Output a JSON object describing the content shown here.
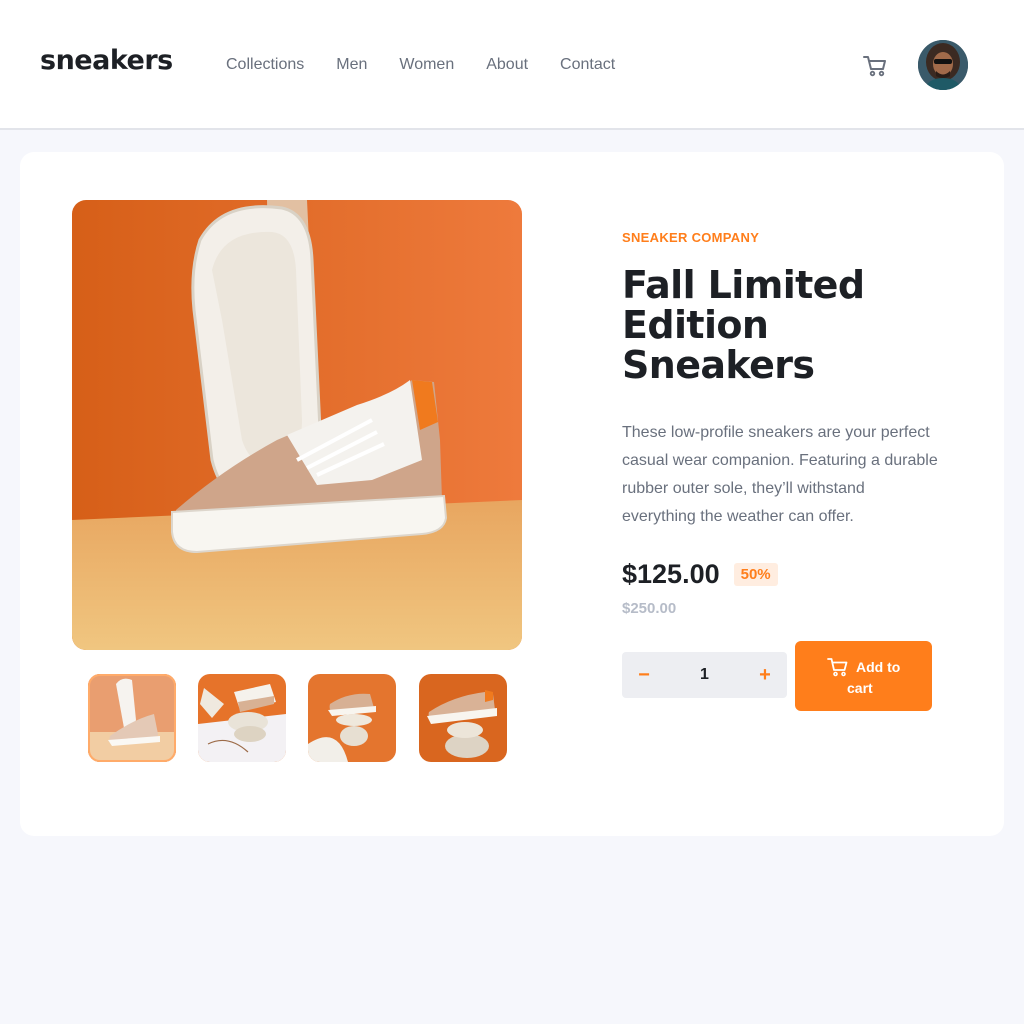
{
  "header": {
    "logo": "sneakers",
    "nav": [
      "Collections",
      "Men",
      "Women",
      "About",
      "Contact"
    ]
  },
  "product": {
    "company": "SNEAKER COMPANY",
    "title_line1": "Fall Limited",
    "title_line2": "Edition Sneakers",
    "description": "These low-profile sneakers are your perfect casual wear companion. Featuring a durable rubber outer sole, they’ll withstand everything the weather can offer.",
    "price": "$125.00",
    "discount": "50%",
    "old_price": "$250.00",
    "quantity": "1",
    "minus_label": "−",
    "plus_label": "+",
    "add_to_cart_line1": "Add to",
    "add_to_cart_line2": "cart",
    "thumbnail_selected": 1,
    "thumbnail_count": 4
  },
  "colors": {
    "accent": "#ff7e1b",
    "accent_pale": "#ffede0",
    "text_dark": "#1d2025",
    "text_grey": "#69707d",
    "page_bg": "#f6f7fc"
  },
  "icons": {
    "cart": "cart-icon",
    "avatar": "user-avatar"
  }
}
